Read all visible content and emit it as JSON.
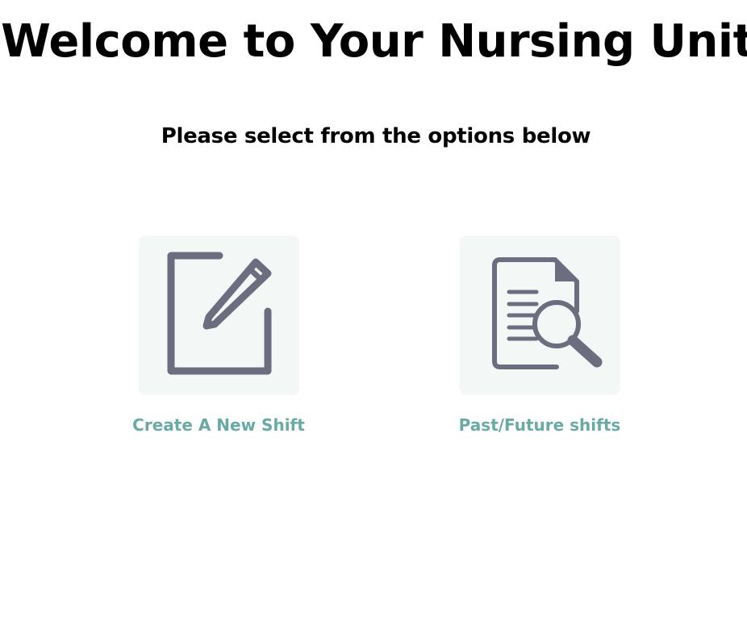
{
  "header": {
    "title": "Welcome to Your Nursing Unit",
    "subtitle": "Please select from the options below"
  },
  "options": [
    {
      "label": "Create A New Shift",
      "icon": "edit-pencil-icon"
    },
    {
      "label": "Past/Future shifts",
      "icon": "document-search-icon"
    }
  ],
  "colors": {
    "tile_background": "#f3f8f6",
    "icon": "#6c6e80",
    "label": "#6aaaa5",
    "text": "#000000"
  }
}
